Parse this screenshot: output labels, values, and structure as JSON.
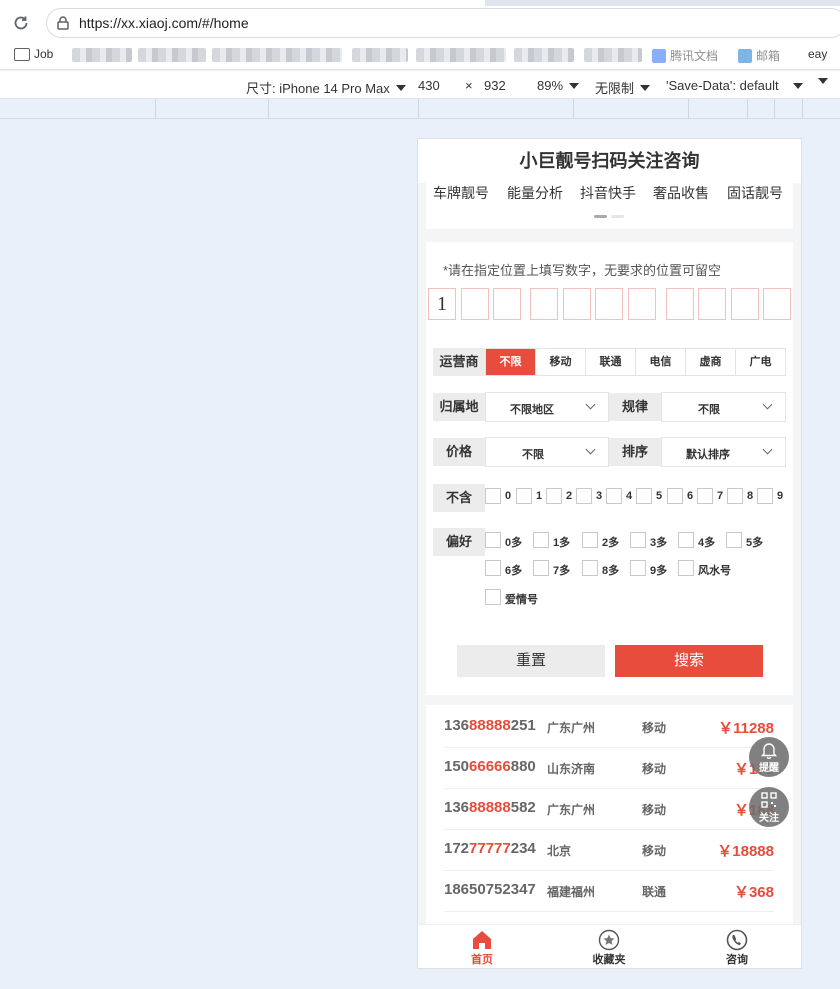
{
  "browser": {
    "url": "https://xx.xiaoj.com/#/home",
    "bookmarks": {
      "job": "Job",
      "b1": "腾讯文档",
      "b2": "邮箱",
      "b3": "eay"
    }
  },
  "devtools": {
    "device_label": "尺寸: iPhone 14 Pro Max",
    "width": "430",
    "times": "×",
    "height": "932",
    "zoom": "89%",
    "throttle": "无限制",
    "save_data": "'Save-Data': default"
  },
  "app": {
    "title": "小巨靓号扫码关注咨询",
    "nav": [
      "车牌靓号",
      "能量分析",
      "抖音快手",
      "奢品收售",
      "固话靓号"
    ],
    "hint": "*请在指定位置上填写数字，无要求的位置可留空",
    "digits": [
      "1",
      "",
      "",
      "",
      "",
      "",
      "",
      "",
      "",
      "",
      ""
    ],
    "carrier": {
      "label": "运营商",
      "options": [
        "不限",
        "移动",
        "联通",
        "电信",
        "虚商",
        "广电"
      ],
      "selected": "不限"
    },
    "location": {
      "label": "归属地",
      "value": "不限地区"
    },
    "rule": {
      "label": "规律",
      "value": "不限"
    },
    "price": {
      "label": "价格",
      "value": "不限"
    },
    "sort": {
      "label": "排序",
      "value": "默认排序"
    },
    "exclude": {
      "label": "不含",
      "options": [
        "0",
        "1",
        "2",
        "3",
        "4",
        "5",
        "6",
        "7",
        "8",
        "9"
      ]
    },
    "prefer": {
      "label": "偏好",
      "options": [
        "0多",
        "1多",
        "2多",
        "3多",
        "4多",
        "5多",
        "6多",
        "7多",
        "8多",
        "9多",
        "风水号",
        "爱情号"
      ]
    },
    "reset_label": "重置",
    "search_label": "搜索",
    "results": [
      {
        "pre": "136",
        "hl": "88888",
        "post": "251",
        "city": "广东广州",
        "op": "移动",
        "price": "￥11288"
      },
      {
        "pre": "150",
        "hl": "66666",
        "post": "880",
        "city": "山东济南",
        "op": "移动",
        "price": "￥178"
      },
      {
        "pre": "136",
        "hl": "88888",
        "post": "582",
        "city": "广东广州",
        "op": "移动",
        "price": "￥188"
      },
      {
        "pre": "172",
        "hl": "77777",
        "post": "234",
        "city": "北京",
        "op": "移动",
        "price": "￥18888"
      },
      {
        "pre": "18650752347",
        "hl": "",
        "post": "",
        "city": "福建福州",
        "op": "联通",
        "price": "￥368"
      }
    ],
    "float_buttons": {
      "remind": "提醒",
      "follow": "关注"
    },
    "tabbar": {
      "home": "首页",
      "favorites": "收藏夹",
      "consult": "咨询"
    },
    "colors": {
      "accent": "#e74c3c"
    }
  }
}
